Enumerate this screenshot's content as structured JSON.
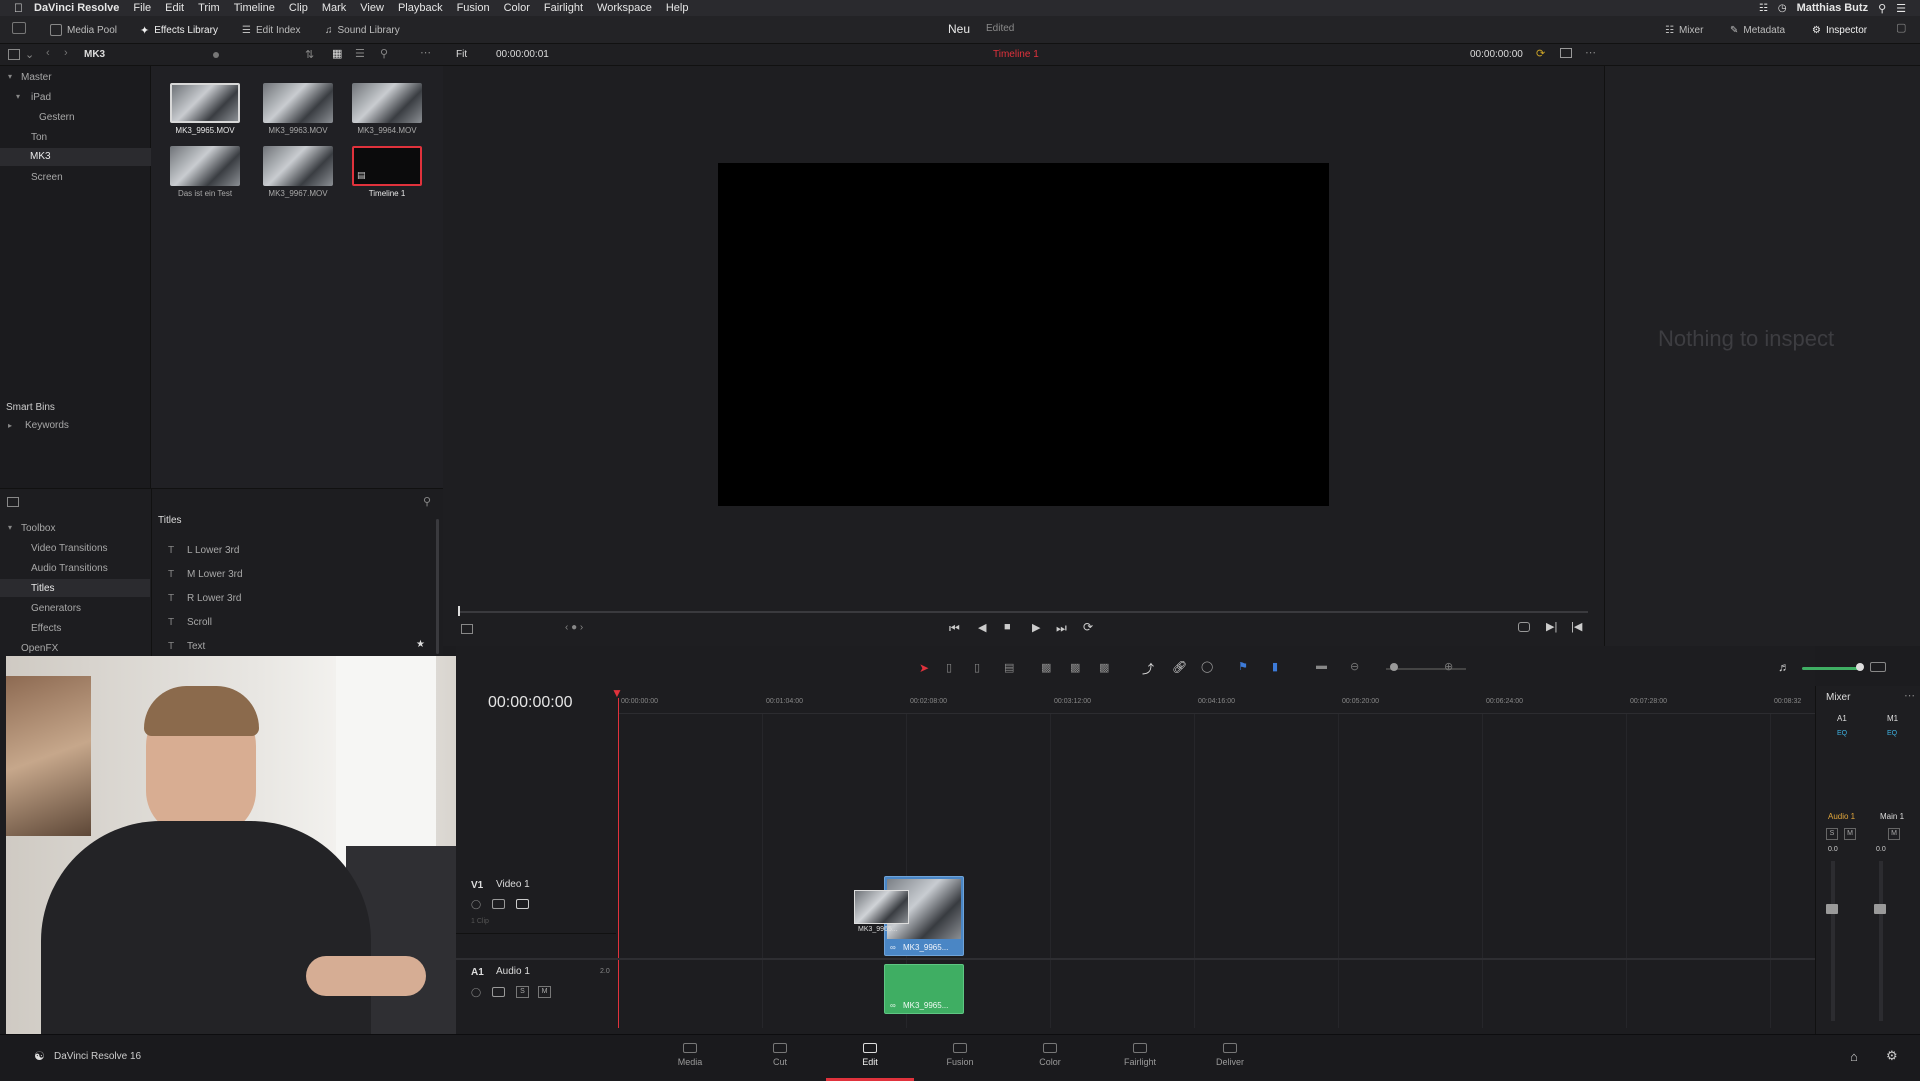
{
  "menubar": {
    "app": "DaVinci Resolve",
    "items": [
      "File",
      "Edit",
      "Trim",
      "Timeline",
      "Clip",
      "Mark",
      "View",
      "Playback",
      "Fusion",
      "Color",
      "Fairlight",
      "Workspace",
      "Help"
    ],
    "user": "Matthias Butz"
  },
  "toolbar": {
    "media_pool": "Media Pool",
    "effects_library": "Effects Library",
    "edit_index": "Edit Index",
    "sound_library": "Sound Library",
    "project_title": "Neu",
    "project_status": "Edited",
    "mixer": "Mixer",
    "metadata": "Metadata",
    "inspector": "Inspector"
  },
  "secbar": {
    "bin_name": "MK3",
    "fit": "Fit",
    "source_tc": "00:00:00:01",
    "timeline_name": "Timeline 1",
    "record_tc": "00:00:00:00"
  },
  "bins": {
    "master": "Master",
    "ipad": "iPad",
    "gestern": "Gestern",
    "ton": "Ton",
    "mk3": "MK3",
    "screen": "Screen",
    "smart_bins": "Smart Bins",
    "keywords": "Keywords"
  },
  "clips": [
    {
      "label": "MK3_9965.MOV"
    },
    {
      "label": "MK3_9963.MOV"
    },
    {
      "label": "MK3_9964.MOV"
    },
    {
      "label": "Das ist ein Test"
    },
    {
      "label": "MK3_9967.MOV"
    },
    {
      "label": "Timeline 1"
    }
  ],
  "inspector": {
    "empty": "Nothing to inspect"
  },
  "effects": {
    "toolbox": "Toolbox",
    "video_transitions": "Video Transitions",
    "audio_transitions": "Audio Transitions",
    "titles": "Titles",
    "generators": "Generators",
    "effects": "Effects",
    "openfx": "OpenFX",
    "titles_header": "Titles",
    "title_items": [
      "L Lower 3rd",
      "M Lower 3rd",
      "R Lower 3rd",
      "Scroll",
      "Text"
    ]
  },
  "timeline": {
    "timecode": "00:00:00:00",
    "ruler": [
      "00:00:00:00",
      "00:01:04:00",
      "00:02:08:00",
      "00:03:12:00",
      "00:04:16:00",
      "00:05:20:00",
      "00:06:24:00",
      "00:07:28:00",
      "00:08:32"
    ],
    "v1_label": "V1",
    "v1_name": "Video 1",
    "v1_clip_count": "1 Clip",
    "a1_label": "A1",
    "a1_name": "Audio 1",
    "a1_channels": "2.0",
    "video_clip_name": "MK3_9965...",
    "drag_clip_name": "MK3_9965...",
    "audio_clip_name": "MK3_9965..."
  },
  "mixer": {
    "title": "Mixer",
    "ch1": "A1",
    "ch2": "M1",
    "eq": "EQ",
    "audio1": "Audio 1",
    "main1": "Main 1",
    "s": "S",
    "m": "M",
    "val1": "0.0",
    "val2": "0.0"
  },
  "bottombar": {
    "app_version": "DaVinci Resolve 16",
    "pages": [
      "Media",
      "Cut",
      "Edit",
      "Fusion",
      "Color",
      "Fairlight",
      "Deliver"
    ],
    "active_page": "Edit"
  },
  "colors": {
    "accent_red": "#e0323c",
    "clip_blue": "#4a86c5",
    "audio_green": "#3fae63",
    "inspector_text": "#3d3d41"
  }
}
